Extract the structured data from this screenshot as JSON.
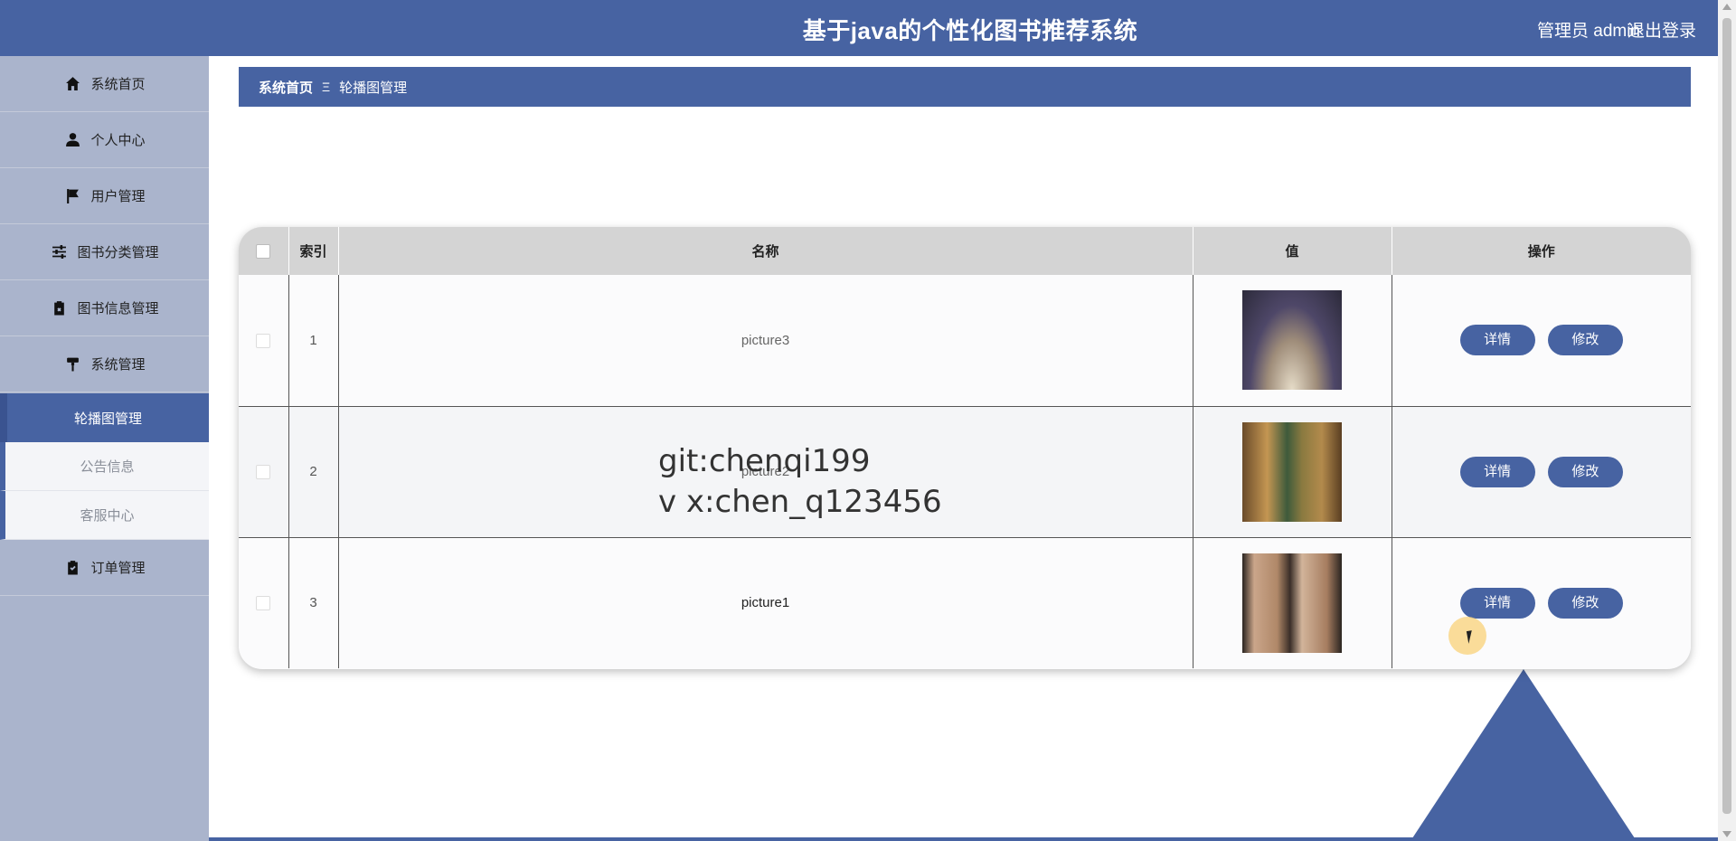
{
  "header": {
    "title": "基于java的个性化图书推荐系统",
    "user": "管理员 admin",
    "logout": "退出登录"
  },
  "sidebar": {
    "items": [
      {
        "label": "系统首页",
        "icon": "home-icon"
      },
      {
        "label": "个人中心",
        "icon": "user-icon"
      },
      {
        "label": "用户管理",
        "icon": "flag-icon"
      },
      {
        "label": "图书分类管理",
        "icon": "sliders-icon"
      },
      {
        "label": "图书信息管理",
        "icon": "clipboard-x-icon"
      },
      {
        "label": "系统管理",
        "icon": "paint-roller-icon"
      }
    ],
    "sub_items": [
      {
        "label": "轮播图管理",
        "active": true
      },
      {
        "label": "公告信息",
        "active": false
      },
      {
        "label": "客服中心",
        "active": false
      }
    ],
    "last_item": {
      "label": "订单管理",
      "icon": "clipboard-check-icon"
    }
  },
  "breadcrumb": {
    "home": "系统首页",
    "separator": "Ξ",
    "current": "轮播图管理"
  },
  "table": {
    "headers": [
      "索引",
      "名称",
      "值",
      "操作"
    ],
    "rows": [
      {
        "index": "1",
        "name": "picture3",
        "thumb": "book-pages-image"
      },
      {
        "index": "2",
        "name": "picture2",
        "thumb": "library-shelves-image"
      },
      {
        "index": "3",
        "name": "picture1",
        "thumb": "bookcover-image"
      }
    ],
    "detail_label": "详情",
    "edit_label": "修改"
  },
  "watermark": {
    "line1": "git:chenqi199",
    "line2": "v x:chen_q123456"
  },
  "colors": {
    "primary": "#4763a2",
    "sidebar_bg": "#aab4cc",
    "header_row": "#d4d4d4"
  }
}
